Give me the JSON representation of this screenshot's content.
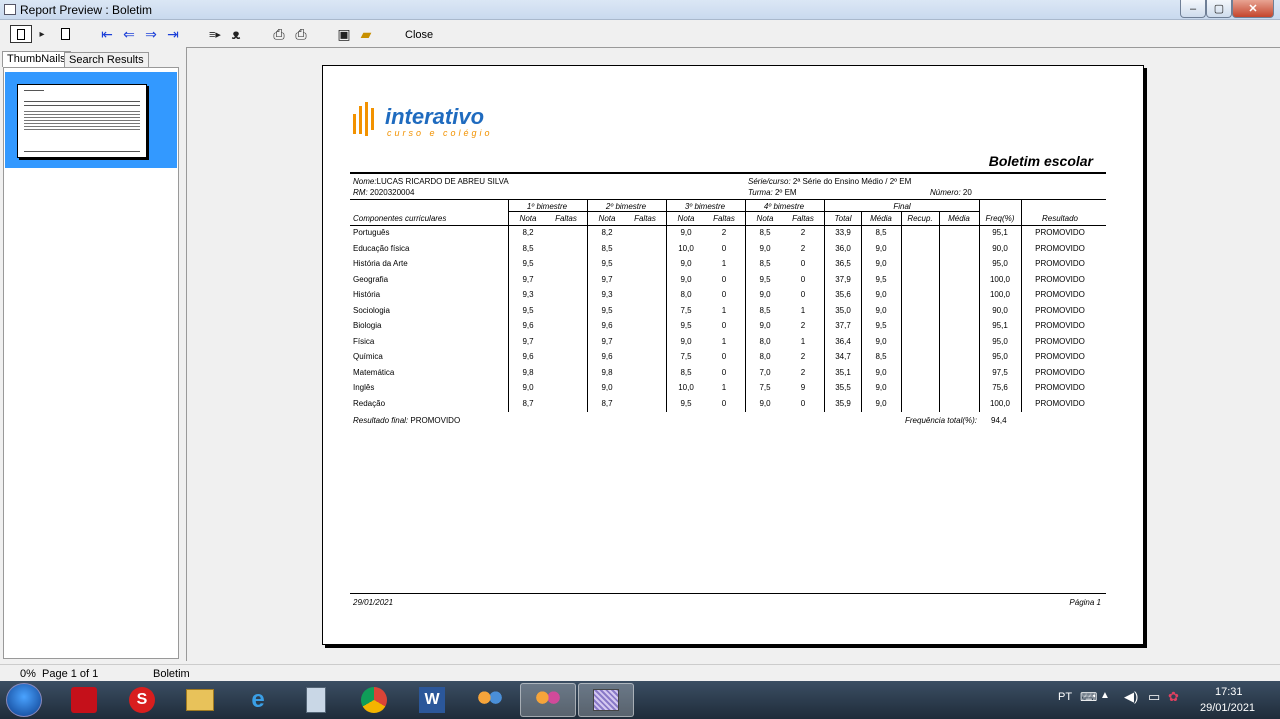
{
  "window": {
    "title": "Report Preview : Boletim",
    "min": "–",
    "max": "▢",
    "close": "✕"
  },
  "toolbar": {
    "icons": [
      "page-frame",
      "pages-arrow",
      "single-page",
      "first-page",
      "previous-page",
      "next-page",
      "last-page",
      "zoom",
      "binoculars",
      "print-setup",
      "print",
      "save",
      "open"
    ],
    "close_label": "Close"
  },
  "tabs": {
    "thumbnails": "ThumbNails",
    "search": "Search Results"
  },
  "report": {
    "logo_text": "interativo",
    "logo_sub": "curso e colégio",
    "title": "Boletim escolar",
    "student": {
      "nome_label": "Nome:",
      "nome": "LUCAS RICARDO DE ABREU SILVA",
      "rm_label": "RM:",
      "rm": "2020320004",
      "serie_label": "Série/curso:",
      "serie": "2ª Série do Ensino Médio / 2º EM",
      "turma_label": "Turma:",
      "turma": "2º EM",
      "numero_label": "Número:",
      "numero": "20"
    },
    "headers": {
      "componentes": "Componentes curriculares",
      "b1": "1º bimestre",
      "b2": "2º bimestre",
      "b3": "3º bimestre",
      "b4": "4º bimestre",
      "final": "Final",
      "nota": "Nota",
      "faltas": "Faltas",
      "total": "Total",
      "media": "Média",
      "recup": "Recup.",
      "media2": "Média",
      "freq": "Freq(%)",
      "resultado": "Resultado"
    },
    "rows": [
      {
        "subject": "Português",
        "n1": "8,2",
        "n2": "8,2",
        "n3": "9,0",
        "f3": "2",
        "n4": "8,5",
        "f4": "2",
        "total": "33,9",
        "media": "8,5",
        "freq": "95,1",
        "result": "PROMOVIDO"
      },
      {
        "subject": "Educação física",
        "n1": "8,5",
        "n2": "8,5",
        "n3": "10,0",
        "f3": "0",
        "n4": "9,0",
        "f4": "2",
        "total": "36,0",
        "media": "9,0",
        "freq": "90,0",
        "result": "PROMOVIDO"
      },
      {
        "subject": "História da Arte",
        "n1": "9,5",
        "n2": "9,5",
        "n3": "9,0",
        "f3": "1",
        "n4": "8,5",
        "f4": "0",
        "total": "36,5",
        "media": "9,0",
        "freq": "95,0",
        "result": "PROMOVIDO"
      },
      {
        "subject": "Geografia",
        "n1": "9,7",
        "n2": "9,7",
        "n3": "9,0",
        "f3": "0",
        "n4": "9,5",
        "f4": "0",
        "total": "37,9",
        "media": "9,5",
        "freq": "100,0",
        "result": "PROMOVIDO"
      },
      {
        "subject": "História",
        "n1": "9,3",
        "n2": "9,3",
        "n3": "8,0",
        "f3": "0",
        "n4": "9,0",
        "f4": "0",
        "total": "35,6",
        "media": "9,0",
        "freq": "100,0",
        "result": "PROMOVIDO"
      },
      {
        "subject": "Sociologia",
        "n1": "9,5",
        "n2": "9,5",
        "n3": "7,5",
        "f3": "1",
        "n4": "8,5",
        "f4": "1",
        "total": "35,0",
        "media": "9,0",
        "freq": "90,0",
        "result": "PROMOVIDO"
      },
      {
        "subject": "Biologia",
        "n1": "9,6",
        "n2": "9,6",
        "n3": "9,5",
        "f3": "0",
        "n4": "9,0",
        "f4": "2",
        "total": "37,7",
        "media": "9,5",
        "freq": "95,1",
        "result": "PROMOVIDO"
      },
      {
        "subject": "Física",
        "n1": "9,7",
        "n2": "9,7",
        "n3": "9,0",
        "f3": "1",
        "n4": "8,0",
        "f4": "1",
        "total": "36,4",
        "media": "9,0",
        "freq": "95,0",
        "result": "PROMOVIDO"
      },
      {
        "subject": "Química",
        "n1": "9,6",
        "n2": "9,6",
        "n3": "7,5",
        "f3": "0",
        "n4": "8,0",
        "f4": "2",
        "total": "34,7",
        "media": "8,5",
        "freq": "95,0",
        "result": "PROMOVIDO"
      },
      {
        "subject": "Matemática",
        "n1": "9,8",
        "n2": "9,8",
        "n3": "8,5",
        "f3": "0",
        "n4": "7,0",
        "f4": "2",
        "total": "35,1",
        "media": "9,0",
        "freq": "97,5",
        "result": "PROMOVIDO"
      },
      {
        "subject": "Inglês",
        "n1": "9,0",
        "n2": "9,0",
        "n3": "10,0",
        "f3": "1",
        "n4": "7,5",
        "f4": "9",
        "total": "35,5",
        "media": "9,0",
        "freq": "75,6",
        "result": "PROMOVIDO"
      },
      {
        "subject": "Redação",
        "n1": "8,7",
        "n2": "8,7",
        "n3": "9,5",
        "f3": "0",
        "n4": "9,0",
        "f4": "0",
        "total": "35,9",
        "media": "9,0",
        "freq": "100,0",
        "result": "PROMOVIDO"
      }
    ],
    "final_result_label": "Resultado final:",
    "final_result": "PROMOVIDO",
    "freq_total_label": "Frequência total(%):",
    "freq_total": "94,4",
    "footer_date": "29/01/2021",
    "footer_page": "Página 1"
  },
  "status": {
    "zoom": "0%",
    "page": "Page 1 of 1",
    "report": "Boletim"
  },
  "taskbar": {
    "apps": [
      "pdf",
      "s-app",
      "explorer",
      "internet-explorer",
      "calculator",
      "chrome",
      "word",
      "people",
      "people2",
      "report-preview"
    ],
    "lang": "PT",
    "time": "17:31",
    "date": "29/01/2021"
  }
}
